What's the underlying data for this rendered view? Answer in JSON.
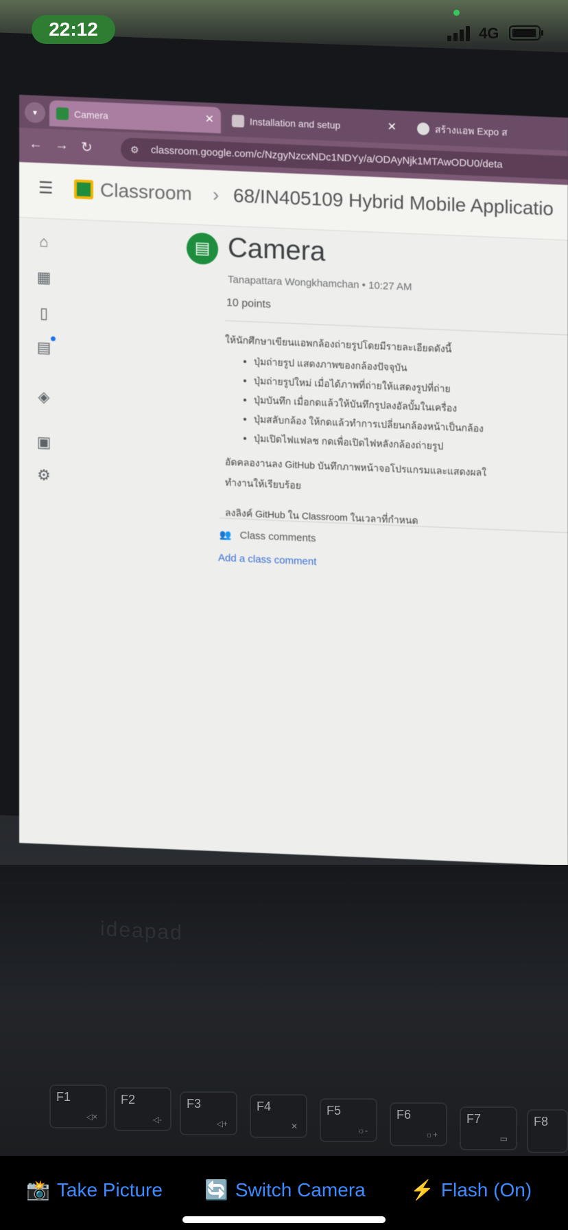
{
  "status_bar": {
    "time": "22:12",
    "network": "4G",
    "signal_bars": 4,
    "battery_level": 0.85
  },
  "browser": {
    "tabs": [
      {
        "label": "Camera",
        "active": true,
        "icon": "classroom-icon"
      },
      {
        "label": "Installation and setup",
        "active": false,
        "icon": "doc-icon"
      },
      {
        "label": "สร้างแอพ Expo ส",
        "active": false,
        "icon": "expo-icon"
      }
    ],
    "url": "classroom.google.com/c/NzgyNzcxNDc1NDYy/a/ODAyNjk1MTAwODU0/deta"
  },
  "classroom": {
    "app_name": "Classroom",
    "course_name": "68/IN405109 Hybrid Mobile Applicatio",
    "assignment": {
      "title": "Camera",
      "author": "Tanapattara Wongkhamchan",
      "time": "10:27 AM",
      "points": "10 points",
      "intro": "ให้นักศึกษาเขียนแอพกล้องถ่ายรูปโดยมีรายละเอียดดังนี้",
      "bullets": [
        "ปุ่มถ่ายรูป แสดงภาพของกล้องปัจจุบัน",
        "ปุ่มถ่ายรูปใหม่ เมื่อได้ภาพที่ถ่ายให้แสดงรูปที่ถ่าย",
        "ปุ่มบันทึก เมื่อกดแล้วให้บันทึกรูปลงอัลบั้มในเครื่อง",
        "ปุ่มสลับกล้อง ให้กดแล้วทำการเปลี่ยนกล้องหน้าเป็นกล้อง",
        "ปุ่มเปิดไฟแฟลช กดเพื่อเปิดไฟหลังกล้องถ่ายรูป"
      ],
      "para1_line1": "อัดคลองานลง GitHub บันทึกภาพหน้าจอโปรแกรมและแสดงผลใ",
      "para1_line2": "ทำงานให้เรียบร้อย",
      "para2": "ลงลิงค์ GitHub ใน Classroom ในเวลาที่กำหนด"
    },
    "comments_label": "Class comments",
    "add_comment_label": "Add a class comment"
  },
  "laptop": {
    "brand": "ideapad",
    "keys": [
      {
        "label": "F1",
        "sub": "◁×"
      },
      {
        "label": "F2",
        "sub": "◁-"
      },
      {
        "label": "F3",
        "sub": "◁+"
      },
      {
        "label": "F4",
        "sub": "✕"
      },
      {
        "label": "F5",
        "sub": "☼-"
      },
      {
        "label": "F6",
        "sub": "☼+"
      },
      {
        "label": "F7",
        "sub": "▭"
      },
      {
        "label": "F8",
        "sub": ""
      }
    ]
  },
  "camera_toolbar": {
    "take_picture": {
      "emoji": "📸",
      "label": "Take Picture"
    },
    "switch_camera": {
      "emoji": "🔄",
      "label": "Switch Camera"
    },
    "flash": {
      "emoji": "⚡",
      "label": "Flash (On)"
    }
  },
  "colors": {
    "toolbar_link": "#3d8bff",
    "time_pill": "#2e7d32",
    "classroom_green": "#1e8e3e",
    "browser_tabbar": "#6b4c66"
  }
}
